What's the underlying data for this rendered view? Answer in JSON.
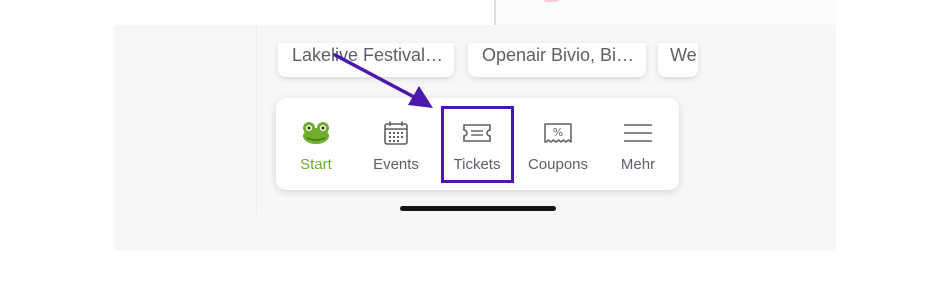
{
  "event_cards": [
    {
      "title": "Lakelive Festival…"
    },
    {
      "title": "Openair Bivio, Bi…"
    },
    {
      "title": "We"
    }
  ],
  "bottom_nav": {
    "items": [
      {
        "label": "Start",
        "icon": "frog-icon",
        "active": true
      },
      {
        "label": "Events",
        "icon": "calendar-icon",
        "active": false
      },
      {
        "label": "Tickets",
        "icon": "ticket-icon",
        "active": false
      },
      {
        "label": "Coupons",
        "icon": "coupon-icon",
        "active": false
      },
      {
        "label": "Mehr",
        "icon": "menu-icon",
        "active": false
      }
    ]
  },
  "annotation": {
    "highlight_color": "#4b18ae",
    "highlighted_item": "Tickets"
  },
  "colors": {
    "active_green": "#6fae2e",
    "text_gray": "#5b6068",
    "screen_bg": "#f6f7f8"
  }
}
